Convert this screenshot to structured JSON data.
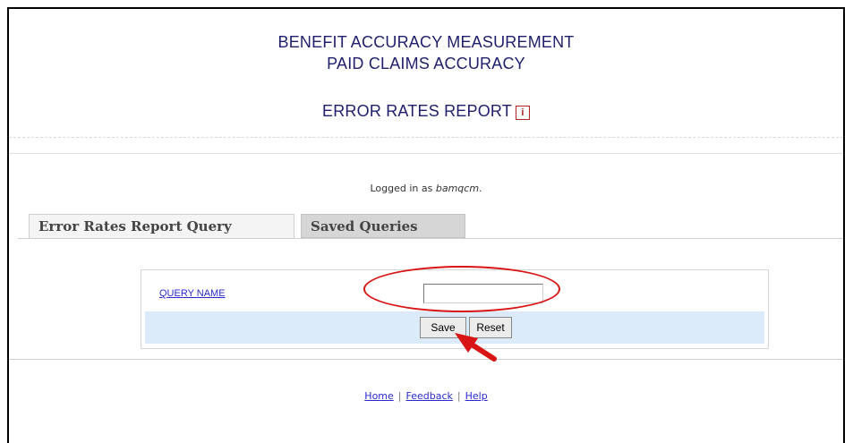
{
  "header": {
    "line1": "BENEFIT ACCURACY MEASUREMENT",
    "line2": "PAID CLAIMS ACCURACY",
    "report_title": "ERROR RATES REPORT",
    "info_glyph": "i"
  },
  "session": {
    "prefix": "Logged in as",
    "username": "bamqcm",
    "suffix": "."
  },
  "tabs": [
    {
      "label": "Error Rates Report Query",
      "active": true
    },
    {
      "label": "Saved Queries",
      "active": false
    }
  ],
  "form": {
    "query_name_label": "QUERY NAME",
    "query_name_value": "",
    "save_label": "Save",
    "reset_label": "Reset"
  },
  "footer": {
    "home": "Home",
    "feedback": "Feedback",
    "help": "Help",
    "separator": "|"
  },
  "annotations": {
    "highlight_color": "#d91414",
    "highlight_oval": "query-name-input",
    "arrow_target": "save-button"
  }
}
